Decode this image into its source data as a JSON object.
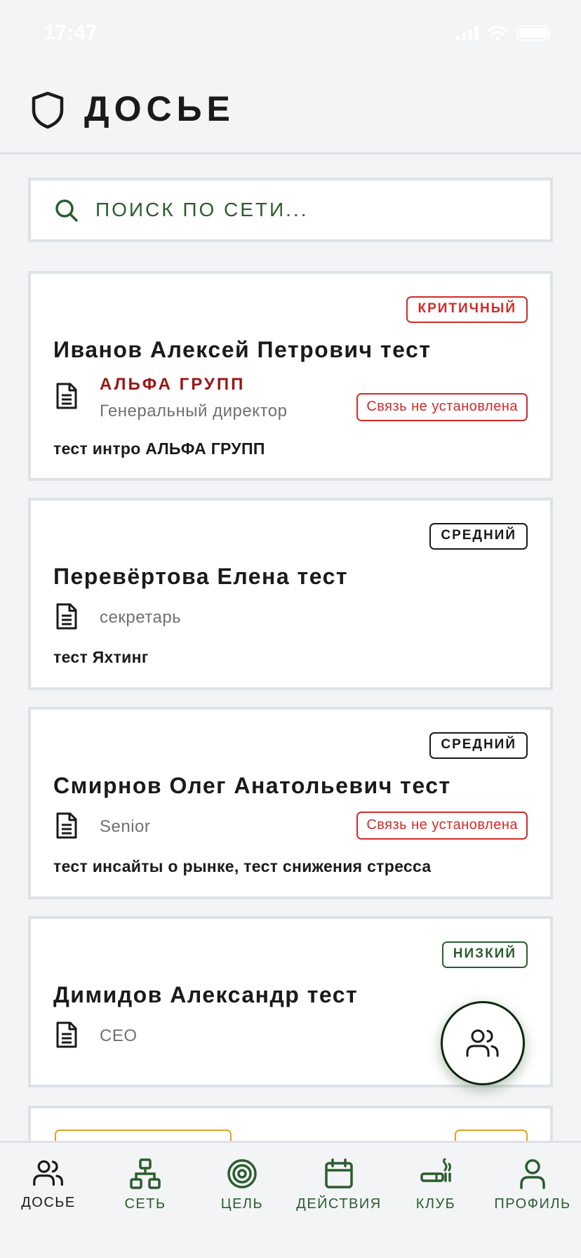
{
  "status_bar": {
    "time": "17:47"
  },
  "header": {
    "title": "ДОСЬЕ",
    "icon": "shield-icon"
  },
  "search": {
    "placeholder": "ПОИСК ПО СЕТИ..."
  },
  "cards": [
    {
      "priority": "КРИТИЧНЫЙ",
      "name": "Иванов Алексей Петрович тест",
      "company": "АЛЬФА ГРУПП",
      "role": "Генеральный директор",
      "connection": "Связь не установлена",
      "note": "тест интро АЛЬФА ГРУПП"
    },
    {
      "priority": "СРЕДНИЙ",
      "name": "Перевёртова Елена тест",
      "role": "секретарь",
      "note": "тест Яхтинг"
    },
    {
      "priority": "СРЕДНИЙ",
      "name": "Смирнов Олег Анатольевич тест",
      "role": "Senior",
      "connection": "Связь не установлена",
      "note": "тест инсайты о рынке, тест снижения стресса"
    },
    {
      "priority": "НИЗКИЙ",
      "name": "Димидов Александр тест",
      "role": "CEO"
    }
  ],
  "fab": {
    "icon": "users-icon"
  },
  "tabs": [
    {
      "label": "ДОСЬЕ",
      "icon": "users-icon",
      "active": true
    },
    {
      "label": "СЕТЬ",
      "icon": "network-icon"
    },
    {
      "label": "ЦЕЛЬ",
      "icon": "target-icon"
    },
    {
      "label": "ДЕЙСТВИЯ",
      "icon": "calendar-icon"
    },
    {
      "label": "КЛУБ",
      "icon": "cigar-icon"
    },
    {
      "label": "ПРОФИЛЬ",
      "icon": "user-icon"
    }
  ],
  "colors": {
    "accent": "#2b5d2e",
    "critical": "#d42a2a",
    "company": "#9c1414",
    "high": "#e0a22a",
    "background": "#f3f4f6",
    "border": "#dde2e6"
  }
}
